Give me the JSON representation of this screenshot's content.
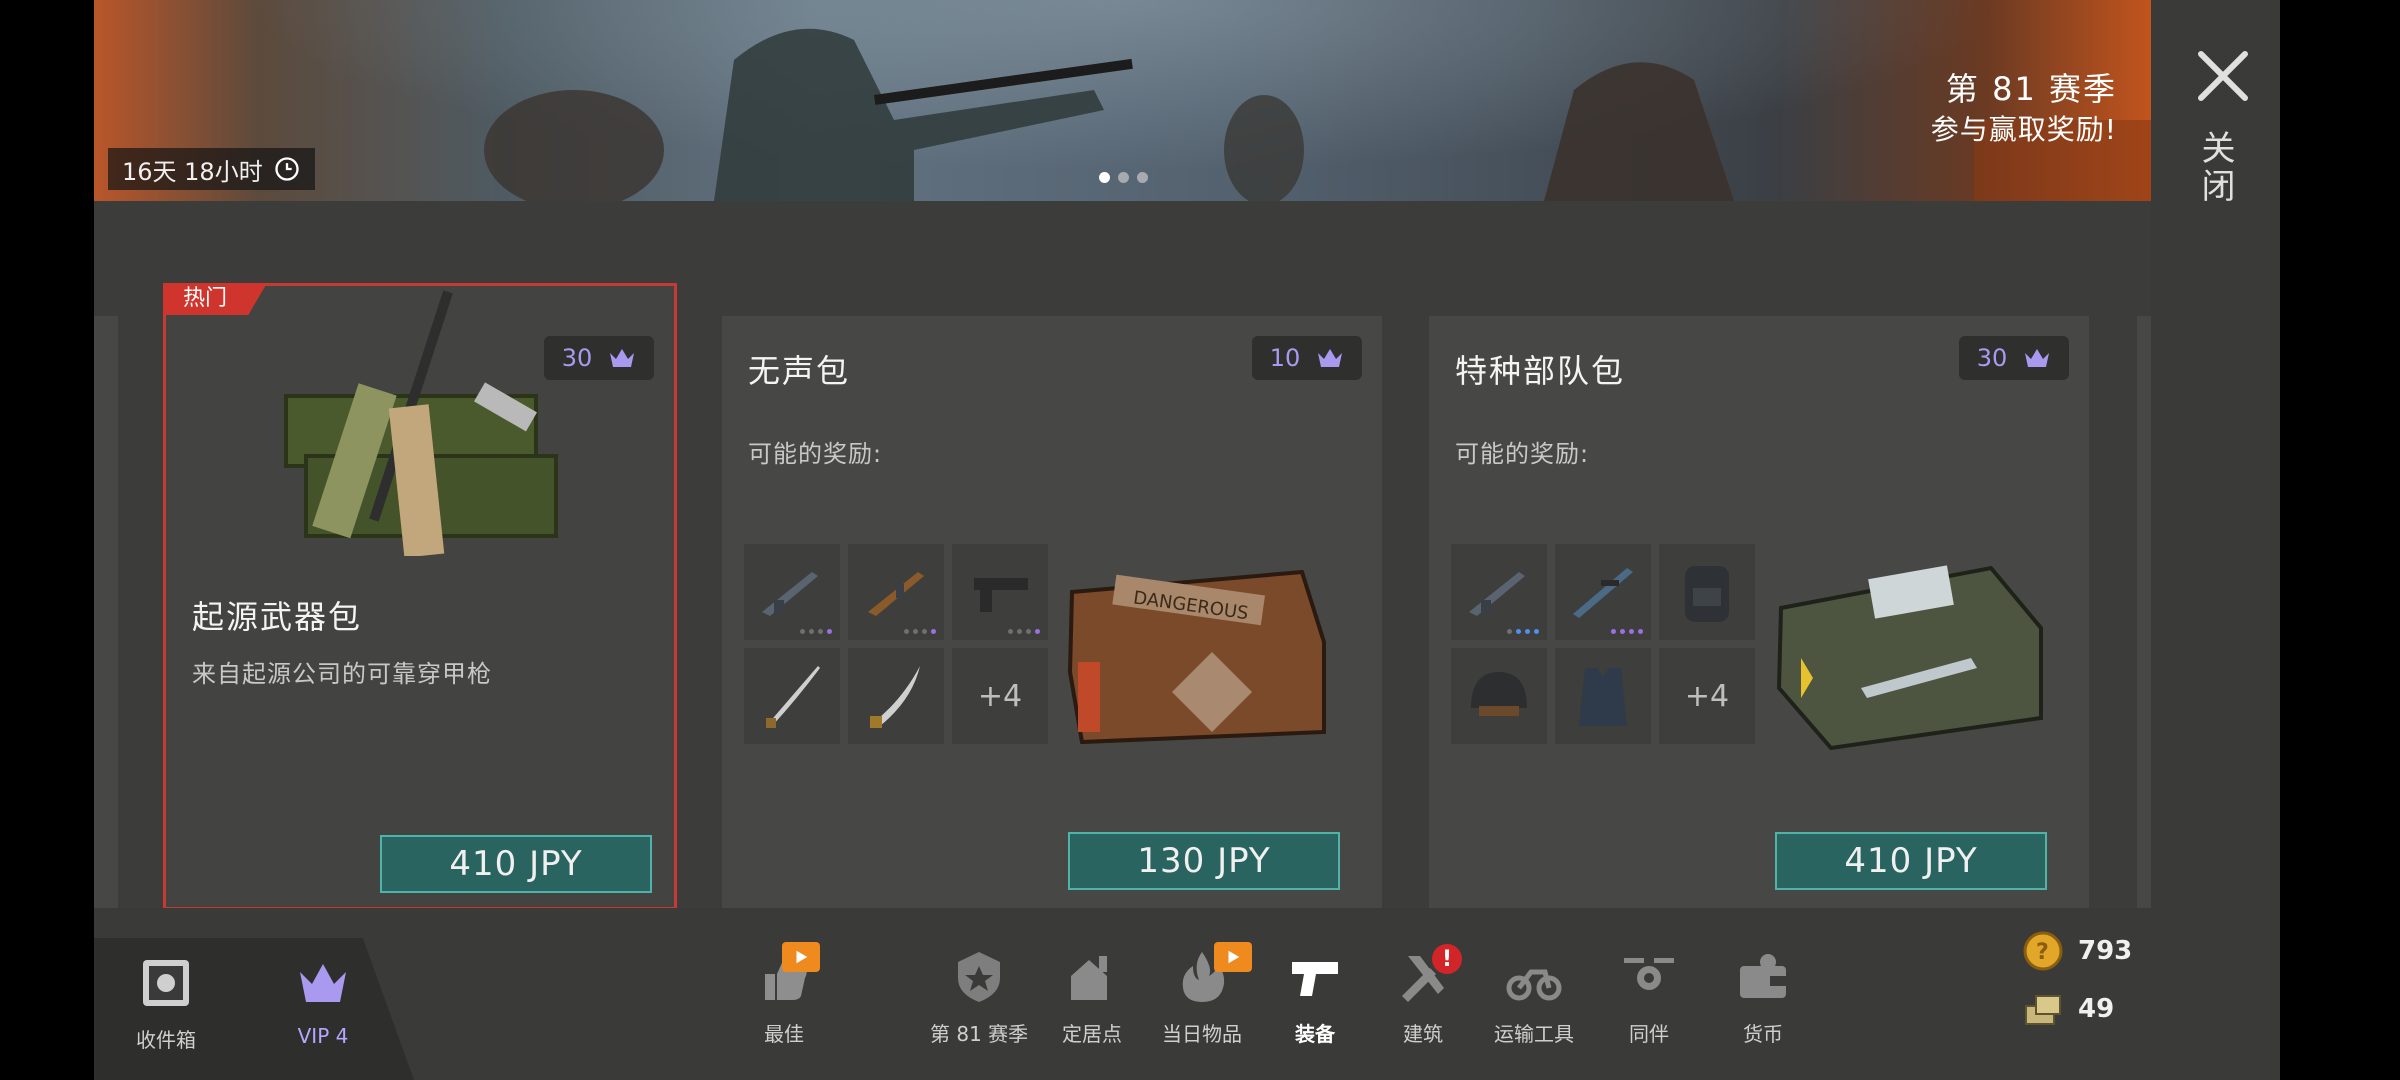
{
  "banner": {
    "timer": "16天 18小时",
    "season_title": "第 81 赛季",
    "season_subtitle": "参与赢取奖励!",
    "page_dots": 3,
    "active_dot": 0
  },
  "close": {
    "label": "关闭"
  },
  "cards": [
    {
      "tag": "热门",
      "vip_points": "30",
      "title": "起源武器包",
      "description": "来自起源公司的可靠穿甲枪",
      "price": "410 JPY"
    },
    {
      "vip_points": "10",
      "title": "无声包",
      "rewards_label": "可能的奖励:",
      "more_label": "+4",
      "price": "130 JPY",
      "box_label": "DANGEROUS"
    },
    {
      "vip_points": "30",
      "title": "特种部队包",
      "rewards_label": "可能的奖励:",
      "more_label": "+4",
      "price": "410 JPY"
    }
  ],
  "bottom_bar": {
    "inbox": "收件箱",
    "vip": "VIP 4",
    "tabs": [
      "最佳",
      "第 81 赛季",
      "定居点",
      "当日物品",
      "装备",
      "建筑",
      "运输工具",
      "同伴",
      "货币"
    ],
    "active_tab": "装备",
    "alert_badge": "!"
  },
  "currency": {
    "coins": "793",
    "cases": "49"
  },
  "colors": {
    "accent_teal": "#2a6460",
    "hot_red": "#d0352d",
    "vip_purple": "#a99af0"
  }
}
